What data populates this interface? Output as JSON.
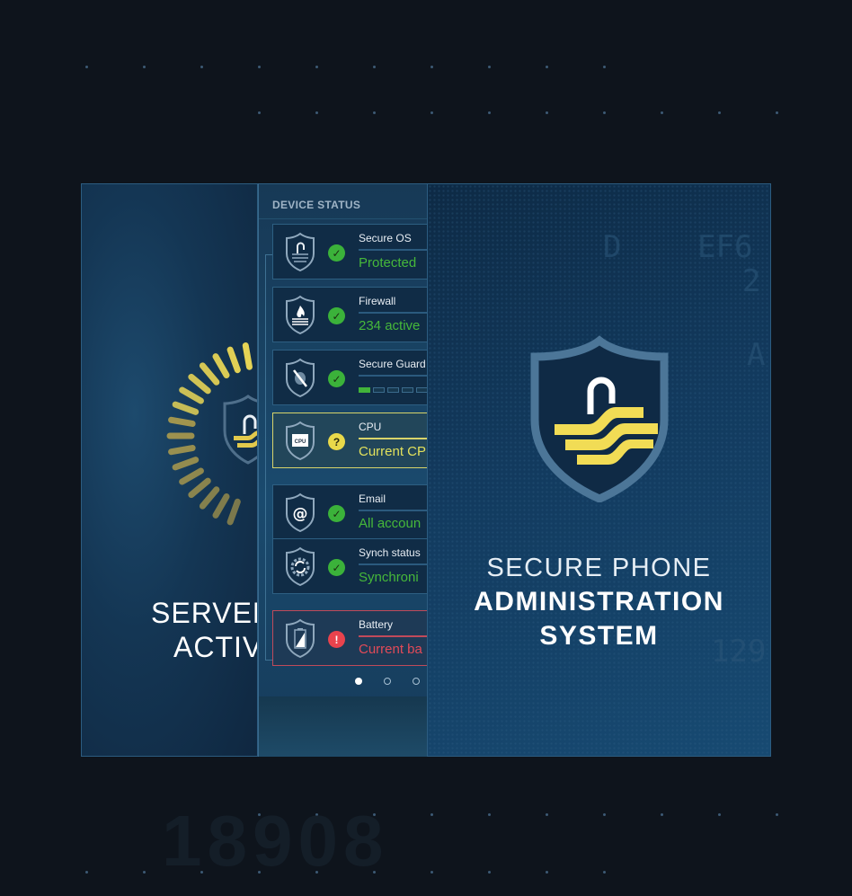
{
  "left_panel": {
    "title_line1": "SERVER",
    "title_line2": "ACTIVA",
    "icon": "loading-spinner-icon",
    "logo_icon": "shield-lock-icon"
  },
  "device_status": {
    "heading": "DEVICE STATUS",
    "items": [
      {
        "label": "Secure OS",
        "value": "Protected",
        "status": "ok",
        "icon": "shield-lock-icon",
        "status_icon": "check-icon",
        "color": "#46b83a"
      },
      {
        "label": "Firewall",
        "value": "234 active",
        "status": "ok",
        "icon": "shield-fire-icon",
        "status_icon": "check-icon",
        "color": "#46b83a"
      },
      {
        "label": "Secure Guard",
        "value": "",
        "status": "ok",
        "icon": "shield-bug-icon",
        "status_icon": "check-icon",
        "progress_segments_on": 1,
        "progress_segments_total": 5
      },
      {
        "label": "CPU",
        "value": "Current CP",
        "status": "warning",
        "icon": "shield-cpu-icon",
        "status_icon": "question-icon",
        "status_glyph": "?",
        "color": "#e2e15c"
      },
      {
        "label": "Email",
        "value": "All accoun",
        "status": "ok",
        "icon": "shield-at-icon",
        "status_icon": "check-icon",
        "color": "#46b83a"
      },
      {
        "label": "Synch status",
        "value": "Synchroni",
        "status": "ok",
        "icon": "shield-sync-icon",
        "status_icon": "check-icon",
        "color": "#46b83a"
      },
      {
        "label": "Battery",
        "value": "Current ba",
        "status": "error",
        "icon": "shield-battery-icon",
        "status_icon": "exclamation-icon",
        "status_glyph": "!",
        "color": "#e24a58"
      }
    ],
    "cpu_chip_text": "CPU",
    "pager": {
      "pages": 3,
      "active": 1
    }
  },
  "right_panel": {
    "title_line1": "SECURE PHONE",
    "title_line2": "ADMINISTRATION",
    "title_line3": "SYSTEM",
    "logo_icon": "shield-lock-icon"
  },
  "colors": {
    "accent_yellow": "#f1dc55",
    "ok_green": "#3bb23a",
    "warn_yellow": "#e9d94a",
    "error_red": "#e9434d",
    "shield_outline": "#4c7698"
  },
  "background_text": "18908"
}
